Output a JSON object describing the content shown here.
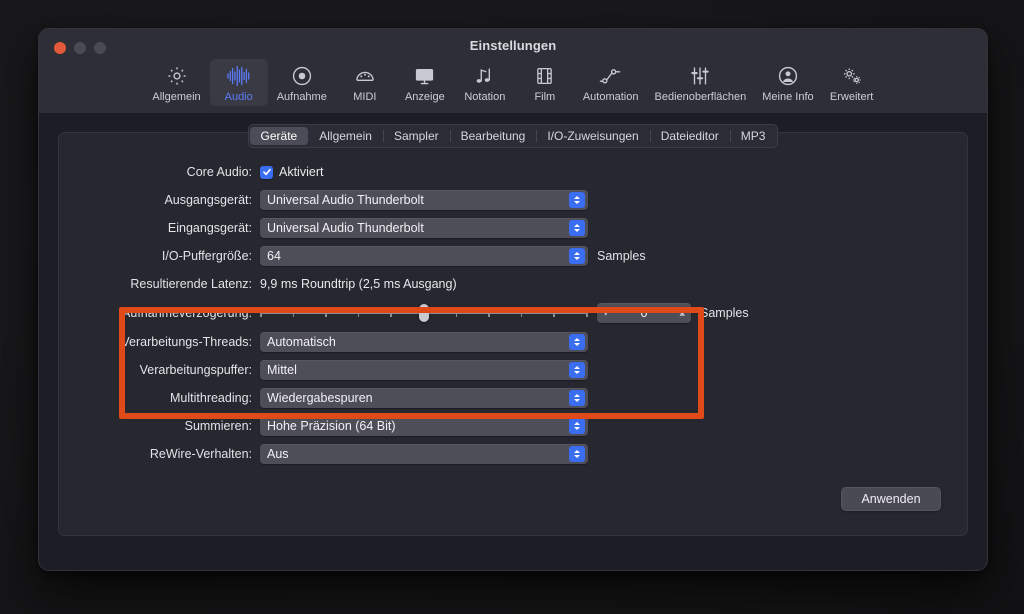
{
  "window": {
    "title": "Einstellungen",
    "traffic_lights": [
      "close",
      "minimize",
      "maximize"
    ]
  },
  "toolbar": {
    "items": [
      {
        "label": "Allgemein",
        "icon": "gear-icon",
        "active": false
      },
      {
        "label": "Audio",
        "icon": "waveform-icon",
        "active": true
      },
      {
        "label": "Aufnahme",
        "icon": "record-icon",
        "active": false
      },
      {
        "label": "MIDI",
        "icon": "midi-plug-icon",
        "active": false
      },
      {
        "label": "Anzeige",
        "icon": "display-icon",
        "active": false
      },
      {
        "label": "Notation",
        "icon": "notes-icon",
        "active": false
      },
      {
        "label": "Film",
        "icon": "filmstrip-icon",
        "active": false
      },
      {
        "label": "Automation",
        "icon": "automation-icon",
        "active": false
      },
      {
        "label": "Bedienoberflächen",
        "icon": "sliders-icon",
        "active": false
      },
      {
        "label": "Meine Info",
        "icon": "person-circle-icon",
        "active": false
      },
      {
        "label": "Erweitert",
        "icon": "double-gear-icon",
        "active": false
      }
    ]
  },
  "tabs": [
    {
      "label": "Geräte",
      "active": true
    },
    {
      "label": "Allgemein",
      "active": false
    },
    {
      "label": "Sampler",
      "active": false
    },
    {
      "label": "Bearbeitung",
      "active": false
    },
    {
      "label": "I/O-Zuweisungen",
      "active": false
    },
    {
      "label": "Dateieditor",
      "active": false
    },
    {
      "label": "MP3",
      "active": false
    }
  ],
  "form": {
    "core_audio": {
      "label": "Core Audio:",
      "checkbox_label": "Aktiviert",
      "checked": true
    },
    "output_device": {
      "label": "Ausgangsgerät:",
      "value": "Universal Audio Thunderbolt"
    },
    "input_device": {
      "label": "Eingangsgerät:",
      "value": "Universal Audio Thunderbolt"
    },
    "buffer_size": {
      "label": "I/O-Puffergröße:",
      "value": "64",
      "suffix": "Samples"
    },
    "latency": {
      "label": "Resultierende Latenz:",
      "value": "9,9 ms Roundtrip (2,5 ms Ausgang)"
    },
    "rec_delay": {
      "label": "Aufnahmeverzögerung:",
      "value": "0",
      "suffix": "Samples",
      "slider_position_pct": 50,
      "tick_count": 11
    },
    "threads": {
      "label": "Verarbeitungs-Threads:",
      "value": "Automatisch"
    },
    "proc_buffer": {
      "label": "Verarbeitungspuffer:",
      "value": "Mittel"
    },
    "multithreading": {
      "label": "Multithreading:",
      "value": "Wiedergabespuren"
    },
    "summing": {
      "label": "Summieren:",
      "value": "Hohe Präzision (64 Bit)"
    },
    "rewire": {
      "label": "ReWire-Verhalten:",
      "value": "Aus"
    }
  },
  "apply_button": {
    "label": "Anwenden"
  },
  "highlight": {
    "color": "#e04918"
  },
  "colors": {
    "accent_blue": "#3a6df0",
    "active_tab_text": "#5a7cf6",
    "highlight_orange": "#e04918",
    "close_button": "#e2593c"
  }
}
